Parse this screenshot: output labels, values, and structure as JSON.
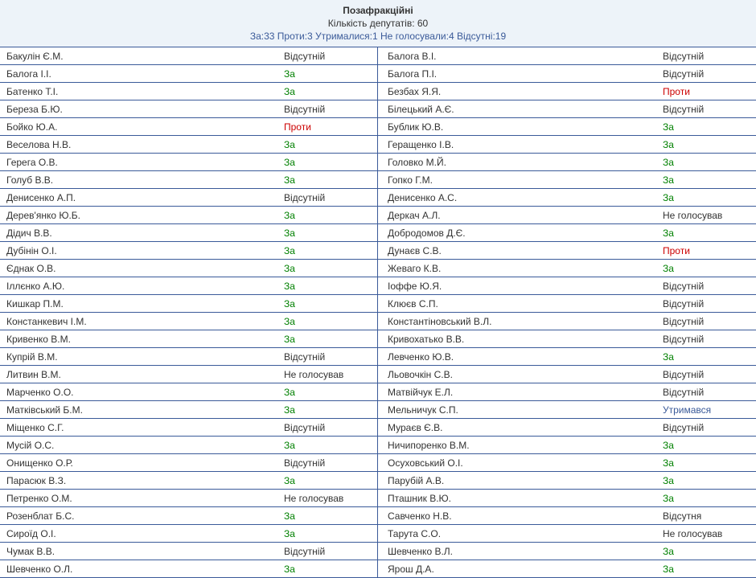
{
  "header": {
    "title": "Позафракційні",
    "count_label": "Кількість депутатів: 60",
    "summary": "За:33 Проти:3 Утрималися:1 Не голосували:4 Відсутні:19"
  },
  "votes": {
    "for": "За",
    "against": "Проти",
    "absent_m": "Відсутній",
    "absent_f": "Відсутня",
    "novote": "Не голосував",
    "abstain": "Утримався"
  },
  "left": [
    {
      "name": "Бакулін Є.М.",
      "vote": "absent_m"
    },
    {
      "name": "Балога І.І.",
      "vote": "for"
    },
    {
      "name": "Батенко Т.І.",
      "vote": "for"
    },
    {
      "name": "Береза Б.Ю.",
      "vote": "absent_m"
    },
    {
      "name": "Бойко Ю.А.",
      "vote": "against"
    },
    {
      "name": "Веселова Н.В.",
      "vote": "for"
    },
    {
      "name": "Герега О.В.",
      "vote": "for"
    },
    {
      "name": "Голуб В.В.",
      "vote": "for"
    },
    {
      "name": "Денисенко А.П.",
      "vote": "absent_m"
    },
    {
      "name": "Дерев'янко Ю.Б.",
      "vote": "for"
    },
    {
      "name": "Дідич В.В.",
      "vote": "for"
    },
    {
      "name": "Дубінін О.І.",
      "vote": "for"
    },
    {
      "name": "Єднак О.В.",
      "vote": "for"
    },
    {
      "name": "Іллєнко А.Ю.",
      "vote": "for"
    },
    {
      "name": "Кишкар П.М.",
      "vote": "for"
    },
    {
      "name": "Констанкевич І.М.",
      "vote": "for"
    },
    {
      "name": "Кривенко В.М.",
      "vote": "for"
    },
    {
      "name": "Купрій В.М.",
      "vote": "absent_m"
    },
    {
      "name": "Литвин В.М.",
      "vote": "novote"
    },
    {
      "name": "Марченко О.О.",
      "vote": "for"
    },
    {
      "name": "Матківський Б.М.",
      "vote": "for"
    },
    {
      "name": "Міщенко С.Г.",
      "vote": "absent_m"
    },
    {
      "name": "Мусій О.С.",
      "vote": "for"
    },
    {
      "name": "Онищенко О.Р.",
      "vote": "absent_m"
    },
    {
      "name": "Парасюк В.З.",
      "vote": "for"
    },
    {
      "name": "Петренко О.М.",
      "vote": "novote"
    },
    {
      "name": "Розенблат Б.С.",
      "vote": "for"
    },
    {
      "name": "Сироїд О.І.",
      "vote": "for"
    },
    {
      "name": "Чумак В.В.",
      "vote": "absent_m"
    },
    {
      "name": "Шевченко О.Л.",
      "vote": "for"
    }
  ],
  "right": [
    {
      "name": "Балога В.І.",
      "vote": "absent_m"
    },
    {
      "name": "Балога П.І.",
      "vote": "absent_m"
    },
    {
      "name": "Безбах Я.Я.",
      "vote": "against"
    },
    {
      "name": "Білецький А.Є.",
      "vote": "absent_m"
    },
    {
      "name": "Бублик Ю.В.",
      "vote": "for"
    },
    {
      "name": "Геращенко І.В.",
      "vote": "for"
    },
    {
      "name": "Головко М.Й.",
      "vote": "for"
    },
    {
      "name": "Гопко Г.М.",
      "vote": "for"
    },
    {
      "name": "Денисенко А.С.",
      "vote": "for"
    },
    {
      "name": "Деркач А.Л.",
      "vote": "novote"
    },
    {
      "name": "Добродомов Д.Є.",
      "vote": "for"
    },
    {
      "name": "Дунаєв С.В.",
      "vote": "against"
    },
    {
      "name": "Жеваго К.В.",
      "vote": "for"
    },
    {
      "name": "Іоффе Ю.Я.",
      "vote": "absent_m"
    },
    {
      "name": "Клюєв С.П.",
      "vote": "absent_m"
    },
    {
      "name": "Константіновський В.Л.",
      "vote": "absent_m"
    },
    {
      "name": "Кривохатько В.В.",
      "vote": "absent_m"
    },
    {
      "name": "Левченко Ю.В.",
      "vote": "for"
    },
    {
      "name": "Льовочкін С.В.",
      "vote": "absent_m"
    },
    {
      "name": "Матвійчук Е.Л.",
      "vote": "absent_m"
    },
    {
      "name": "Мельничук С.П.",
      "vote": "abstain"
    },
    {
      "name": "Мураєв Є.В.",
      "vote": "absent_m"
    },
    {
      "name": "Ничипоренко В.М.",
      "vote": "for"
    },
    {
      "name": "Осуховський О.І.",
      "vote": "for"
    },
    {
      "name": "Парубій А.В.",
      "vote": "for"
    },
    {
      "name": "Пташник В.Ю.",
      "vote": "for"
    },
    {
      "name": "Савченко Н.В.",
      "vote": "absent_f"
    },
    {
      "name": "Тарута С.О.",
      "vote": "novote"
    },
    {
      "name": "Шевченко В.Л.",
      "vote": "for"
    },
    {
      "name": "Ярош Д.А.",
      "vote": "for"
    }
  ]
}
